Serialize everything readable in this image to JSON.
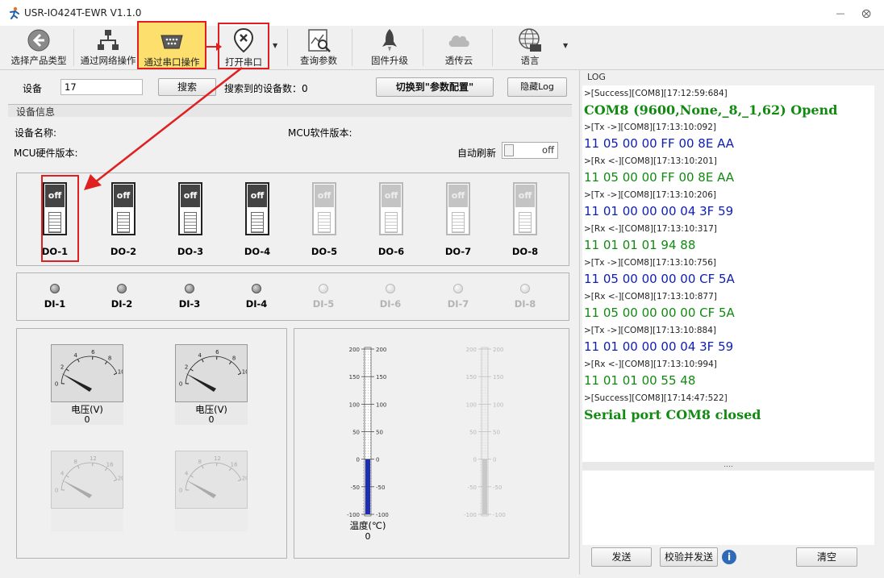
{
  "window": {
    "title": "USR-IO424T-EWR V1.1.0",
    "min": "—",
    "close": "⨂"
  },
  "toolbar": {
    "select_product": "选择产品类型",
    "via_network": "通过网络操作",
    "via_serial": "通过串口操作",
    "open_port": "打开串口",
    "query_params": "查询参数",
    "firmware": "固件升级",
    "cloud": "透传云",
    "language": "语言"
  },
  "device_bar": {
    "device_label": "设备",
    "device_value": "17",
    "search": "搜索",
    "found_label": "搜索到的设备数：0",
    "switch_btn": "切换到\"参数配置\"",
    "hide_log": "隐藏Log"
  },
  "info": {
    "header": "设备信息",
    "device_name": "设备名称:",
    "mcu_sw": "MCU软件版本:",
    "mcu_hw": "MCU硬件版本:",
    "auto_refresh": "自动刷新",
    "toggle": "off"
  },
  "do": [
    {
      "label": "DO-1",
      "state": "off"
    },
    {
      "label": "DO-2",
      "state": "off"
    },
    {
      "label": "DO-3",
      "state": "off"
    },
    {
      "label": "DO-4",
      "state": "off"
    },
    {
      "label": "DO-5",
      "state": "off"
    },
    {
      "label": "DO-6",
      "state": "off"
    },
    {
      "label": "DO-7",
      "state": "off"
    },
    {
      "label": "DO-8",
      "state": "off"
    }
  ],
  "di": [
    "DI-1",
    "DI-2",
    "DI-3",
    "DI-4",
    "DI-5",
    "DI-6",
    "DI-7",
    "DI-8"
  ],
  "gauges": [
    {
      "label": "电压(V)",
      "value": "0",
      "ticks": [
        "0",
        "2",
        "4",
        "6",
        "8",
        "10"
      ]
    },
    {
      "label": "电压(V)",
      "value": "0",
      "ticks": [
        "0",
        "2",
        "4",
        "6",
        "8",
        "10"
      ]
    },
    {
      "label": "",
      "value": "",
      "ticks": [
        "0",
        "4",
        "8",
        "12",
        "16",
        "20"
      ]
    },
    {
      "label": "",
      "value": "",
      "ticks": [
        "0",
        "4",
        "8",
        "12",
        "16",
        "20"
      ]
    }
  ],
  "thermo": {
    "ticks": [
      "200",
      "150",
      "100",
      "50",
      "0",
      "-50",
      "-100"
    ],
    "label": "温度(℃)",
    "value": "0",
    "fill_level": 0
  },
  "log": {
    "title": "LOG",
    "lines": [
      {
        "text": ">[Success][COM8][17:12:59:684]",
        "kind": "meta"
      },
      {
        "text": "COM8 (9600,None,_8,_1,62) Opend",
        "kind": "big"
      },
      {
        "text": ">[Tx ->][COM8][17:13:10:092]",
        "kind": "meta"
      },
      {
        "text": "11 05 00 00 FF 00 8E AA",
        "kind": "tx"
      },
      {
        "text": ">[Rx <-][COM8][17:13:10:201]",
        "kind": "meta"
      },
      {
        "text": "11 05 00 00 FF 00 8E AA",
        "kind": "rx"
      },
      {
        "text": ">[Tx ->][COM8][17:13:10:206]",
        "kind": "meta"
      },
      {
        "text": "11 01 00 00 00 04 3F 59",
        "kind": "tx"
      },
      {
        "text": ">[Rx <-][COM8][17:13:10:317]",
        "kind": "meta"
      },
      {
        "text": "11 01 01 01 94 88",
        "kind": "rx"
      },
      {
        "text": ">[Tx ->][COM8][17:13:10:756]",
        "kind": "meta"
      },
      {
        "text": "11 05 00 00 00 00 CF 5A",
        "kind": "tx"
      },
      {
        "text": ">[Rx <-][COM8][17:13:10:877]",
        "kind": "meta"
      },
      {
        "text": "11 05 00 00 00 00 CF 5A",
        "kind": "rx"
      },
      {
        "text": ">[Tx ->][COM8][17:13:10:884]",
        "kind": "meta"
      },
      {
        "text": "11 01 00 00 00 04 3F 59",
        "kind": "tx"
      },
      {
        "text": ">[Rx <-][COM8][17:13:10:994]",
        "kind": "meta"
      },
      {
        "text": "11 01 01 00 55 48",
        "kind": "rx"
      },
      {
        "text": ">[Success][COM8][17:14:47:522]",
        "kind": "meta"
      },
      {
        "text": "Serial port COM8 closed",
        "kind": "big"
      }
    ],
    "splitter": "....",
    "send": "发送",
    "verify_send": "校验并发送",
    "clear": "清空"
  },
  "colors": {
    "accent_active": "#fddf6e",
    "highlight": "#e02020",
    "tx": "#1020b0",
    "rx": "#118a11"
  }
}
